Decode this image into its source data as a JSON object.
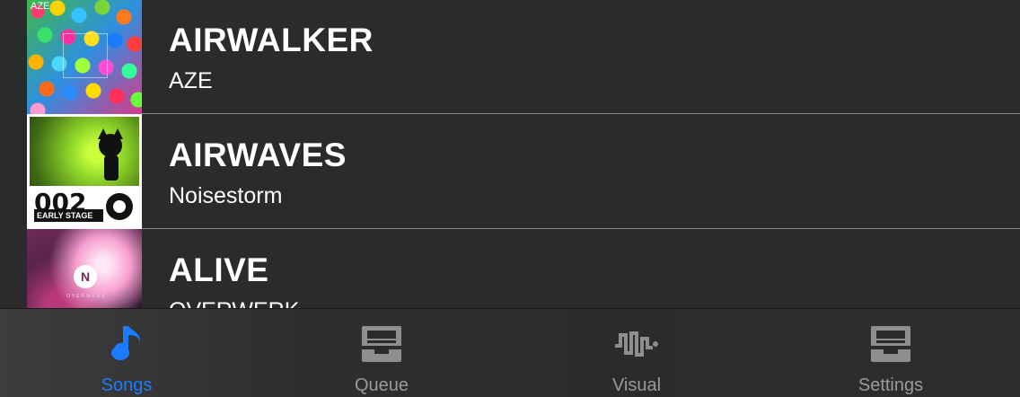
{
  "songs": [
    {
      "title": "AIRWALKER",
      "artist": "AZE",
      "art_label": "AZE"
    },
    {
      "title": "AIRWAVES",
      "artist": "Noisestorm",
      "art_number": "002",
      "art_stage": "EARLY STAGE"
    },
    {
      "title": "ALIVE",
      "artist": "OVERWERK",
      "art_initial": "N",
      "art_brand": "OVERWERK"
    }
  ],
  "tabs": [
    {
      "label": "Songs",
      "icon": "music-note-icon",
      "active": true
    },
    {
      "label": "Queue",
      "icon": "tray-icon",
      "active": false
    },
    {
      "label": "Visual",
      "icon": "waveform-icon",
      "active": false
    },
    {
      "label": "Settings",
      "icon": "tray-icon",
      "active": false
    }
  ],
  "colors": {
    "background": "#2b2b2b",
    "accent": "#1a7cff",
    "inactive": "#9a9a9a",
    "divider": "#8a8a8a"
  }
}
